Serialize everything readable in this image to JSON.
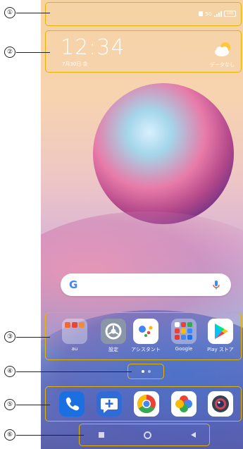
{
  "callouts": [
    "①",
    "②",
    "③",
    "④",
    "⑤",
    "⑥"
  ],
  "status_bar": {
    "network_label": "5G",
    "battery_label": "100"
  },
  "clock_widget": {
    "time": "12:34",
    "date": "7月30日 金",
    "weather_text": "データなし"
  },
  "search_bar": {
    "logo": "G"
  },
  "apps": [
    {
      "label": "au",
      "icon": "au-folder-icon"
    },
    {
      "label": "設定",
      "icon": "settings-gear-icon"
    },
    {
      "label": "アシスタント",
      "icon": "google-assistant-icon"
    },
    {
      "label": "Google",
      "icon": "google-folder-icon"
    },
    {
      "label": "Play ストア",
      "icon": "play-store-icon"
    }
  ],
  "page_indicator": {
    "pages": 2,
    "current": 1
  },
  "dock": [
    "phone-icon",
    "messages-icon",
    "chrome-icon",
    "photos-icon",
    "camera-icon"
  ],
  "nav_bar": [
    "recents-square-icon",
    "home-circle-icon",
    "back-triangle-icon"
  ],
  "colors": {
    "frame": "#e5b400",
    "callout_text": "#222222"
  }
}
